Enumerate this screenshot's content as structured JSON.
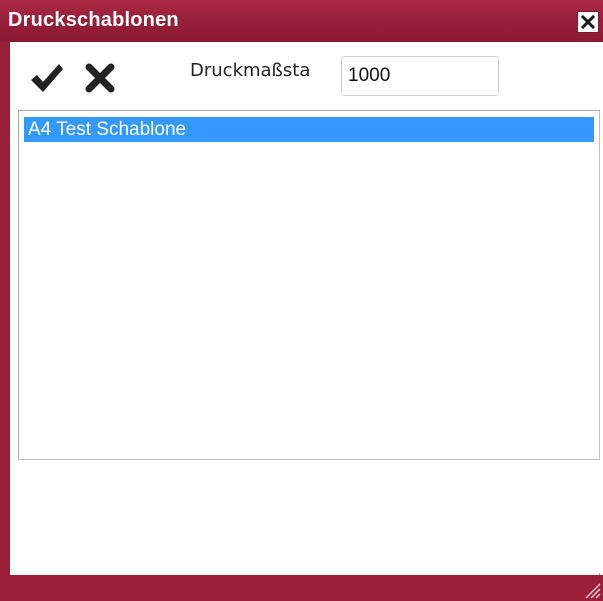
{
  "window": {
    "title": "Druckschablonen",
    "accent_color": "#9c1f3a",
    "selection_color": "#3399ff"
  },
  "toolbar": {
    "ok_icon": "checkmark-icon",
    "cancel_icon": "cross-icon",
    "scale_label": "Druckmaßsta",
    "scale_value": "1000"
  },
  "templates": {
    "items": [
      {
        "label": "A4 Test Schablone",
        "selected": true
      }
    ]
  }
}
